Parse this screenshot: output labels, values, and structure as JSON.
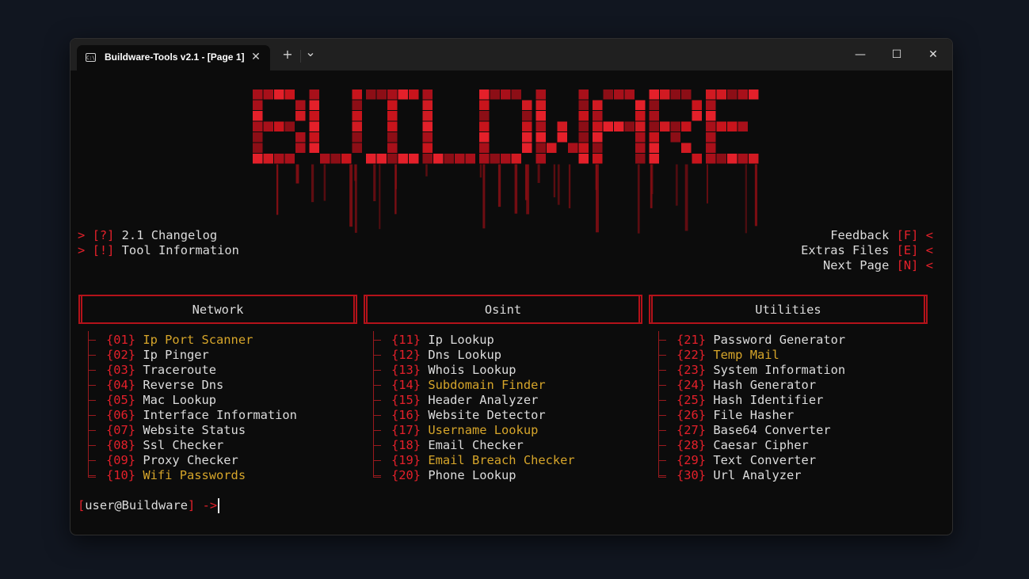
{
  "window": {
    "tab_title": "Buildware-Tools v2.1 - [Page 1]",
    "tab_icon": "terminal-icon",
    "close_tab_glyph": "✕",
    "new_tab_glyph": "+",
    "dropdown_glyph": "⌄",
    "minimize_glyph": "—",
    "maximize_glyph": "☐",
    "close_glyph": "✕"
  },
  "logo": {
    "text": "BUILDWARE",
    "color": "#e4202a"
  },
  "left_menu": [
    {
      "prefix": ">",
      "key": "[?]",
      "label": "2.1 Changelog"
    },
    {
      "prefix": ">",
      "key": "[!]",
      "label": "Tool Information"
    }
  ],
  "right_menu": [
    {
      "label": "Feedback",
      "key": "[F]",
      "suffix": "<"
    },
    {
      "label": "Extras Files",
      "key": "[E]",
      "suffix": "<"
    },
    {
      "label": "Next Page",
      "key": "[N]",
      "suffix": "<"
    }
  ],
  "columns": [
    {
      "title": "Network",
      "items": [
        {
          "num": "{01}",
          "label": "Ip Port Scanner",
          "highlight": true
        },
        {
          "num": "{02}",
          "label": "Ip Pinger",
          "highlight": false
        },
        {
          "num": "{03}",
          "label": "Traceroute",
          "highlight": false
        },
        {
          "num": "{04}",
          "label": "Reverse Dns",
          "highlight": false
        },
        {
          "num": "{05}",
          "label": "Mac Lookup",
          "highlight": false
        },
        {
          "num": "{06}",
          "label": "Interface Information",
          "highlight": false
        },
        {
          "num": "{07}",
          "label": "Website Status",
          "highlight": false
        },
        {
          "num": "{08}",
          "label": "Ssl Checker",
          "highlight": false
        },
        {
          "num": "{09}",
          "label": "Proxy Checker",
          "highlight": false
        },
        {
          "num": "{10}",
          "label": "Wifi Passwords",
          "highlight": true
        }
      ]
    },
    {
      "title": "Osint",
      "items": [
        {
          "num": "{11}",
          "label": "Ip Lookup",
          "highlight": false
        },
        {
          "num": "{12}",
          "label": "Dns Lookup",
          "highlight": false
        },
        {
          "num": "{13}",
          "label": "Whois Lookup",
          "highlight": false
        },
        {
          "num": "{14}",
          "label": "Subdomain Finder",
          "highlight": true
        },
        {
          "num": "{15}",
          "label": "Header Analyzer",
          "highlight": false
        },
        {
          "num": "{16}",
          "label": "Website Detector",
          "highlight": false
        },
        {
          "num": "{17}",
          "label": "Username Lookup",
          "highlight": true
        },
        {
          "num": "{18}",
          "label": "Email Checker",
          "highlight": false
        },
        {
          "num": "{19}",
          "label": "Email Breach Checker",
          "highlight": true
        },
        {
          "num": "{20}",
          "label": "Phone Lookup",
          "highlight": false
        }
      ]
    },
    {
      "title": "Utilities",
      "items": [
        {
          "num": "{21}",
          "label": "Password Generator",
          "highlight": false
        },
        {
          "num": "{22}",
          "label": "Temp Mail",
          "highlight": true
        },
        {
          "num": "{23}",
          "label": "System Information",
          "highlight": false
        },
        {
          "num": "{24}",
          "label": "Hash Generator",
          "highlight": false
        },
        {
          "num": "{25}",
          "label": "Hash Identifier",
          "highlight": false
        },
        {
          "num": "{26}",
          "label": "File Hasher",
          "highlight": false
        },
        {
          "num": "{27}",
          "label": "Base64 Converter",
          "highlight": false
        },
        {
          "num": "{28}",
          "label": "Caesar Cipher",
          "highlight": false
        },
        {
          "num": "{29}",
          "label": "Text Converter",
          "highlight": false
        },
        {
          "num": "{30}",
          "label": "Url Analyzer",
          "highlight": false
        }
      ]
    }
  ],
  "prompt": {
    "open": "[",
    "user": "user@Buildware",
    "close": "]",
    "arrow": "->"
  },
  "colors": {
    "accent": "#e4202a",
    "highlight": "#d6a52a",
    "text": "#dcdcdc",
    "background": "#0c0c0c"
  }
}
